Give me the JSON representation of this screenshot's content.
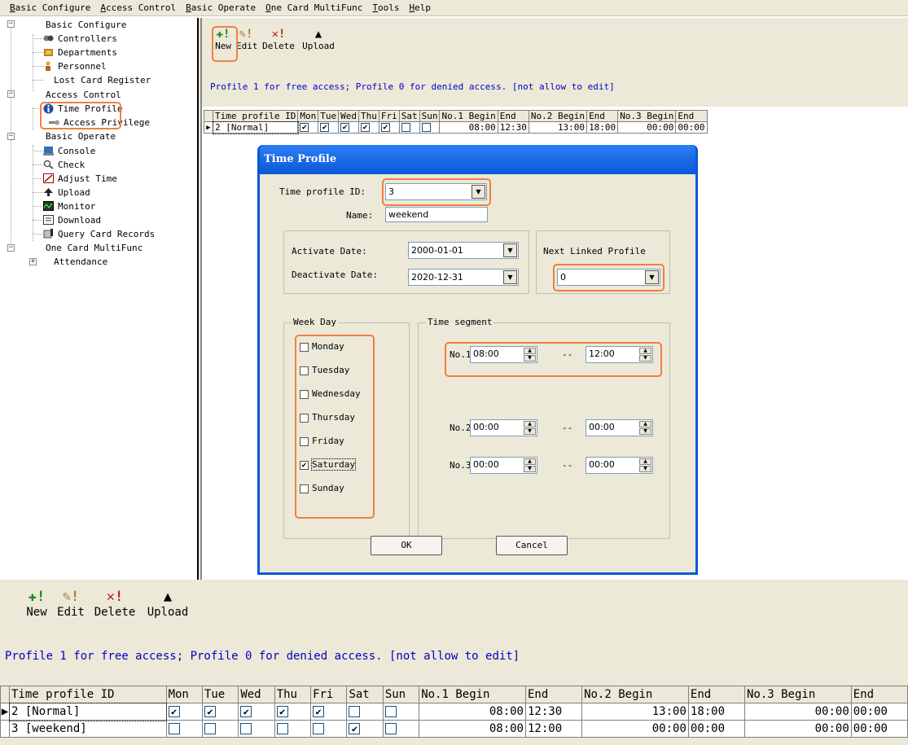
{
  "menu": [
    "Basic Configure",
    "Access Control",
    "Basic Operate",
    "One Card MultiFunc",
    "Tools",
    "Help"
  ],
  "tree": {
    "basic_configure": "Basic Configure",
    "controllers": "Controllers",
    "departments": "Departments",
    "personnel": "Personnel",
    "lost_card_register": "Lost Card Register",
    "access_control": "Access Control",
    "time_profile": "Time Profile",
    "access_privilege": "Access Privilege",
    "basic_operate": "Basic Operate",
    "console": "Console",
    "check": "Check",
    "adjust_time": "Adjust Time",
    "upload": "Upload",
    "monitor": "Monitor",
    "download": "Download",
    "query_card_records": "Query Card Records",
    "one_card_multifunc": "One Card MultiFunc",
    "attendance": "Attendance"
  },
  "toolbar": {
    "new_label": "New",
    "edit_label": "Edit",
    "delete_label": "Delete",
    "upload_label": "Upload"
  },
  "info_text": "Profile 1 for free access; Profile 0  for denied access. [not allow to edit]",
  "grid": {
    "headers": [
      "Time profile ID",
      "Mon",
      "Tue",
      "Wed",
      "Thu",
      "Fri",
      "Sat",
      "Sun",
      "No.1 Begin",
      "End",
      "No.2 Begin",
      "End",
      "No.3 Begin",
      "End"
    ],
    "rows": [
      {
        "id": "2 [Normal]",
        "days": [
          true,
          true,
          true,
          true,
          true,
          false,
          false
        ],
        "times": [
          "08:00",
          "12:30",
          "13:00",
          "18:00",
          "00:00",
          "00:00"
        ]
      },
      {
        "id": "3 [weekend]",
        "days": [
          false,
          false,
          false,
          false,
          false,
          true,
          false
        ],
        "times": [
          "08:00",
          "12:00",
          "00:00",
          "00:00",
          "00:00",
          "00:00"
        ]
      }
    ]
  },
  "dialog": {
    "title": "Time Profile",
    "profile_id_label": "Time profile ID:",
    "profile_id_value": "3",
    "name_label": "Name:",
    "name_value": "weekend",
    "activate_label": "Activate Date:",
    "activate_value": "2000-01-01",
    "deactivate_label": "Deactivate Date:",
    "deactivate_value": "2020-12-31",
    "next_linked_label": "Next Linked Profile",
    "next_linked_value": "0",
    "weekday_caption": "Week Day",
    "weekdays": [
      {
        "label": "Monday",
        "checked": false
      },
      {
        "label": "Tuesday",
        "checked": false
      },
      {
        "label": "Wednesday",
        "checked": false
      },
      {
        "label": "Thursday",
        "checked": false
      },
      {
        "label": "Friday",
        "checked": false
      },
      {
        "label": "Saturday",
        "checked": true
      },
      {
        "label": "Sunday",
        "checked": false
      }
    ],
    "segment_caption": "Time segment",
    "segments": [
      {
        "label": "No.1:",
        "begin": "08:00",
        "end": "12:00"
      },
      {
        "label": "No.2:",
        "begin": "00:00",
        "end": "00:00"
      },
      {
        "label": "No.3:",
        "begin": "00:00",
        "end": "00:00"
      }
    ],
    "separator": "--",
    "ok_label": "OK",
    "cancel_label": "Cancel"
  },
  "colors": {
    "highlight": "#f08040",
    "info_text": "#0000c8",
    "dialog_title": "#0a58d8",
    "face": "#ece9d8"
  }
}
